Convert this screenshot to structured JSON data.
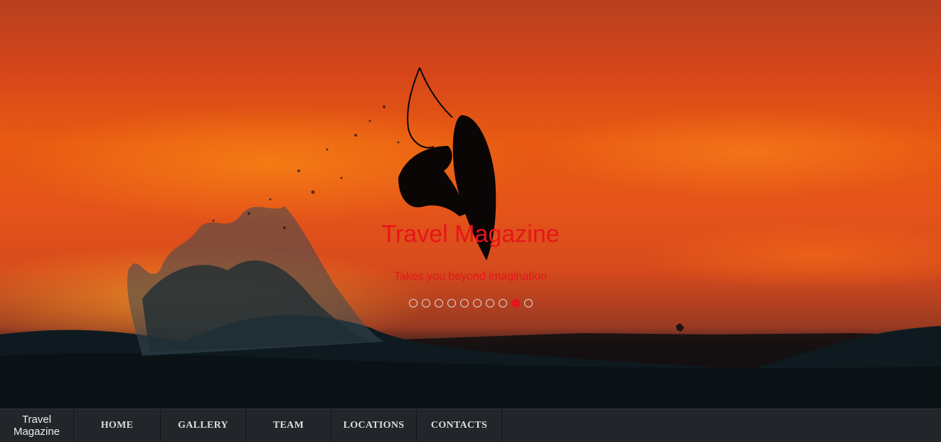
{
  "hero": {
    "title": "Travel Magazine",
    "tagline": "Takes you beyond imagination",
    "slides_total": 10,
    "active_slide": 9
  },
  "navbar": {
    "brand": "Travel Magazine",
    "items": [
      "HOME",
      "GALLERY",
      "TEAM",
      "LOCATIONS",
      "CONTACTS"
    ]
  },
  "colors": {
    "title": "#e8141a",
    "navbar_bg": "#22262b",
    "active_dot": "#e8141a"
  }
}
